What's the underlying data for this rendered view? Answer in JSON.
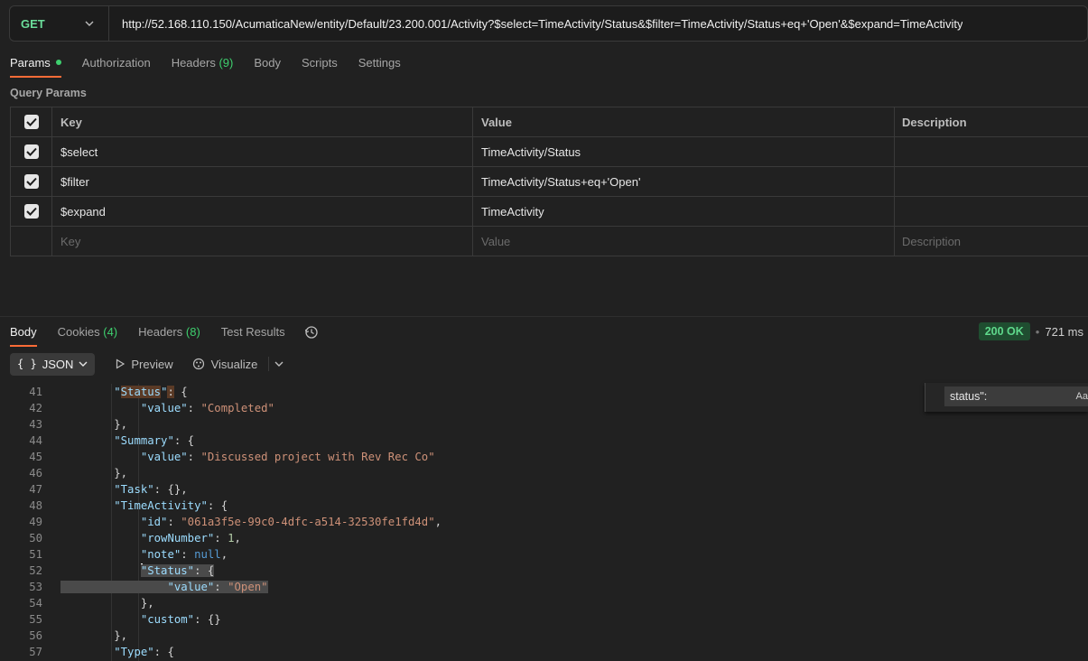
{
  "request": {
    "method": "GET",
    "url": "http://52.168.110.150/AcumaticaNew/entity/Default/23.200.001/Activity?$select=TimeActivity/Status&$filter=TimeActivity/Status+eq+'Open'&$expand=TimeActivity"
  },
  "request_tabs": {
    "params": "Params",
    "authorization": "Authorization",
    "headers": "Headers",
    "headers_count": "(9)",
    "body": "Body",
    "scripts": "Scripts",
    "settings": "Settings"
  },
  "query_params": {
    "title": "Query Params",
    "columns": {
      "key": "Key",
      "value": "Value",
      "description": "Description"
    },
    "rows": [
      {
        "key": "$select",
        "value": "TimeActivity/Status",
        "description": ""
      },
      {
        "key": "$filter",
        "value": "TimeActivity/Status+eq+'Open'",
        "description": ""
      },
      {
        "key": "$expand",
        "value": "TimeActivity",
        "description": ""
      }
    ],
    "placeholder": {
      "key": "Key",
      "value": "Value",
      "description": "Description"
    }
  },
  "response_tabs": {
    "body": "Body",
    "cookies": "Cookies",
    "cookies_count": "(4)",
    "headers": "Headers",
    "headers_count": "(8)",
    "test_results": "Test Results"
  },
  "response_status": {
    "code": "200 OK",
    "separator": "•",
    "time": "721 ms"
  },
  "response_toolbar": {
    "format": "JSON",
    "preview": "Preview",
    "visualize": "Visualize"
  },
  "find": {
    "query": "status\":",
    "match_case": "Aa"
  },
  "colors": {
    "accent": "#ff6c37",
    "get_method": "#6bdd9a",
    "ok_status": "#5fd98c"
  },
  "code_lines": [
    {
      "n": "41",
      "t": [
        [
          "sp",
          "        "
        ],
        [
          "k",
          "\""
        ],
        [
          "k match",
          "Status"
        ],
        [
          "k",
          "\""
        ],
        [
          "p match",
          ":"
        ],
        [
          "p",
          " {"
        ]
      ]
    },
    {
      "n": "42",
      "t": [
        [
          "sp",
          "            "
        ],
        [
          "k",
          "\"value\""
        ],
        [
          "p",
          ": "
        ],
        [
          "s",
          "\"Completed\""
        ]
      ]
    },
    {
      "n": "43",
      "t": [
        [
          "sp",
          "        "
        ],
        [
          "p",
          "},"
        ]
      ]
    },
    {
      "n": "44",
      "t": [
        [
          "sp",
          "        "
        ],
        [
          "k",
          "\"Summary\""
        ],
        [
          "p",
          ": {"
        ]
      ]
    },
    {
      "n": "45",
      "t": [
        [
          "sp",
          "            "
        ],
        [
          "k",
          "\"value\""
        ],
        [
          "p",
          ": "
        ],
        [
          "s",
          "\"Discussed project with Rev Rec Co\""
        ]
      ]
    },
    {
      "n": "46",
      "t": [
        [
          "sp",
          "        "
        ],
        [
          "p",
          "},"
        ]
      ]
    },
    {
      "n": "47",
      "t": [
        [
          "sp",
          "        "
        ],
        [
          "k",
          "\"Task\""
        ],
        [
          "p",
          ": {},"
        ]
      ]
    },
    {
      "n": "48",
      "t": [
        [
          "sp",
          "        "
        ],
        [
          "k",
          "\"TimeActivity\""
        ],
        [
          "p",
          ": {"
        ]
      ]
    },
    {
      "n": "49",
      "t": [
        [
          "sp",
          "            "
        ],
        [
          "k",
          "\"id\""
        ],
        [
          "p",
          ": "
        ],
        [
          "s",
          "\"061a3f5e-99c0-4dfc-a514-32530fe1fd4d\""
        ],
        [
          "p",
          ","
        ]
      ]
    },
    {
      "n": "50",
      "t": [
        [
          "sp",
          "            "
        ],
        [
          "k",
          "\"rowNumber\""
        ],
        [
          "p",
          ": "
        ],
        [
          "n",
          "1"
        ],
        [
          "p",
          ","
        ]
      ]
    },
    {
      "n": "51",
      "t": [
        [
          "sp",
          "            "
        ],
        [
          "k",
          "\"note\""
        ],
        [
          "p",
          ": "
        ],
        [
          "nl",
          "null"
        ],
        [
          "p",
          ","
        ]
      ]
    },
    {
      "n": "52",
      "t": [
        [
          "sp",
          "            "
        ],
        [
          "caret",
          ""
        ],
        [
          "k selbg",
          "\""
        ],
        [
          "k selbg match",
          "Status"
        ],
        [
          "k selbg",
          "\""
        ],
        [
          "p selbg match",
          ":"
        ],
        [
          "p selbg",
          " {"
        ]
      ]
    },
    {
      "n": "53",
      "t": [
        [
          "selbg",
          "                "
        ],
        [
          "k selbg",
          "\"value\""
        ],
        [
          "p selbg",
          ": "
        ],
        [
          "s selbg",
          "\"Open\""
        ]
      ]
    },
    {
      "n": "54",
      "t": [
        [
          "sp",
          "            "
        ],
        [
          "p",
          "},"
        ]
      ]
    },
    {
      "n": "55",
      "t": [
        [
          "sp",
          "            "
        ],
        [
          "k",
          "\"custom\""
        ],
        [
          "p",
          ": {}"
        ]
      ]
    },
    {
      "n": "56",
      "t": [
        [
          "sp",
          "        "
        ],
        [
          "p",
          "},"
        ]
      ]
    },
    {
      "n": "57",
      "t": [
        [
          "sp",
          "        "
        ],
        [
          "k",
          "\"Type\""
        ],
        [
          "p",
          ": {"
        ]
      ]
    }
  ]
}
